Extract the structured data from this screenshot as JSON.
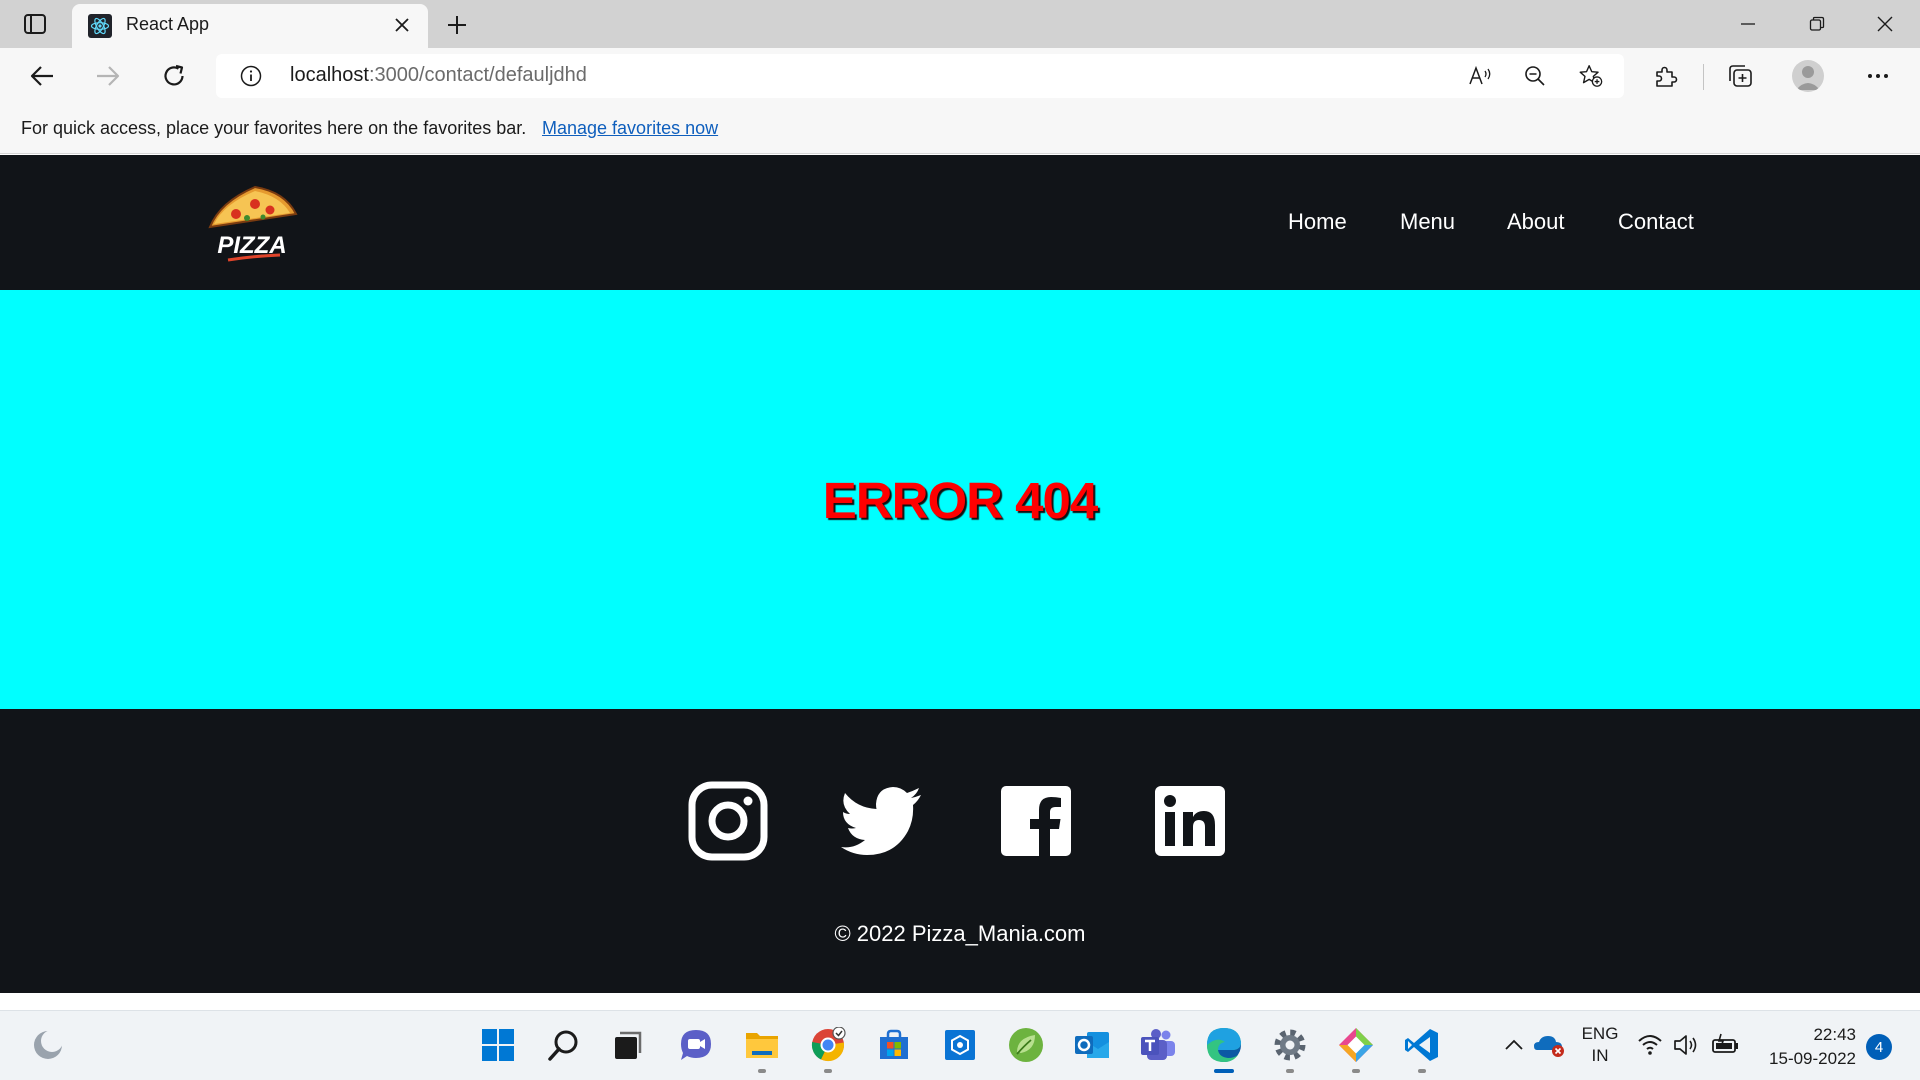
{
  "browser": {
    "tab": {
      "title": "React App",
      "favicon": "react-icon"
    },
    "address": {
      "host": "localhost",
      "path": ":3000/contact/defauljdhd"
    },
    "favorites_bar": {
      "message": "For quick access, place your favorites here on the favorites bar.",
      "link": "Manage favorites now"
    }
  },
  "site": {
    "logo_alt": "PIZZA",
    "nav": [
      {
        "label": "Home"
      },
      {
        "label": "Menu"
      },
      {
        "label": "About"
      },
      {
        "label": "Contact"
      }
    ],
    "error_message": "ERROR 404",
    "social": [
      "instagram-icon",
      "twitter-icon",
      "facebook-icon",
      "linkedin-icon"
    ],
    "copyright": "© 2022 Pizza_Mania.com"
  },
  "taskbar": {
    "language_line1": "ENG",
    "language_line2": "IN",
    "time": "22:43",
    "date": "15-09-2022",
    "notifications": "4"
  },
  "colors": {
    "header_bg": "#111418",
    "hero_bg": "#00ffff",
    "error_text": "#ff0000",
    "link": "#0f5fbd"
  }
}
